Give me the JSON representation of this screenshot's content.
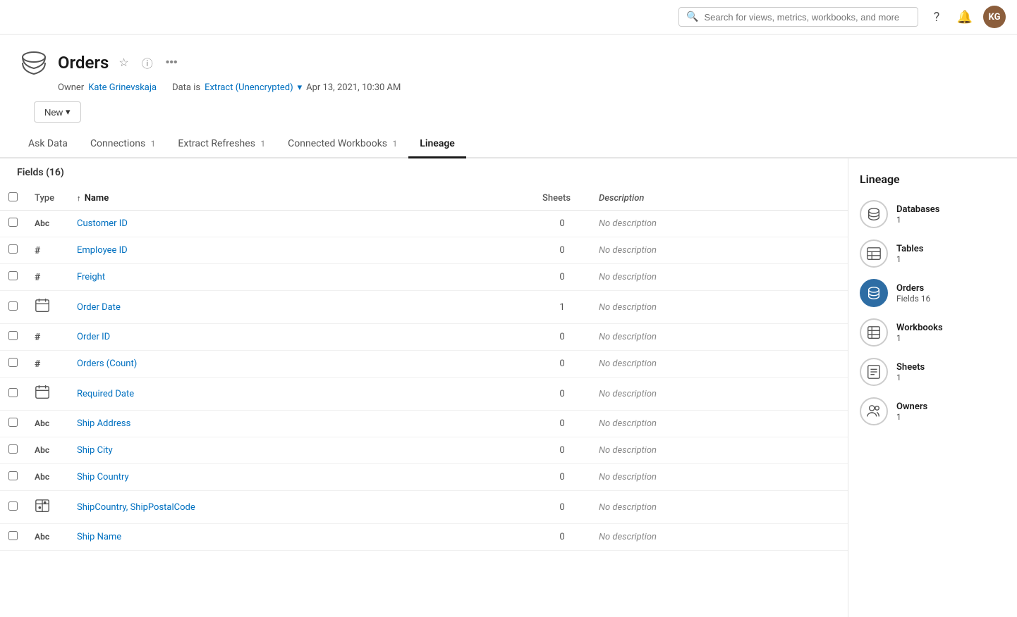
{
  "topnav": {
    "search_placeholder": "Search for views, metrics, workbooks, and more",
    "avatar_initials": "KG"
  },
  "header": {
    "title": "Orders",
    "owner_label": "Owner",
    "owner_name": "Kate Grinevskaja",
    "data_is_label": "Data is",
    "extract_label": "Extract (Unencrypted)",
    "date_label": "Apr 13, 2021, 10:30 AM",
    "new_button": "New"
  },
  "tabs": [
    {
      "id": "ask-data",
      "label": "Ask Data",
      "count": null
    },
    {
      "id": "connections",
      "label": "Connections",
      "count": "1"
    },
    {
      "id": "extract-refreshes",
      "label": "Extract Refreshes",
      "count": "1"
    },
    {
      "id": "connected-workbooks",
      "label": "Connected Workbooks",
      "count": "1"
    },
    {
      "id": "lineage",
      "label": "Lineage",
      "count": null,
      "active": true
    }
  ],
  "fields_section": {
    "heading": "Fields (16)",
    "columns": {
      "type": "Type",
      "name": "Name",
      "sheets": "Sheets",
      "description": "Description"
    },
    "sort_indicator": "↑",
    "rows": [
      {
        "type": "Abc",
        "type_icon": "abc",
        "name": "Customer ID",
        "sheets": 0,
        "description": "No description"
      },
      {
        "type": "#",
        "type_icon": "hash",
        "name": "Employee ID",
        "sheets": 0,
        "description": "No description"
      },
      {
        "type": "#",
        "type_icon": "hash",
        "name": "Freight",
        "sheets": 0,
        "description": "No description"
      },
      {
        "type": "cal",
        "type_icon": "calendar",
        "name": "Order Date",
        "sheets": 1,
        "description": "No description"
      },
      {
        "type": "#",
        "type_icon": "hash",
        "name": "Order ID",
        "sheets": 0,
        "description": "No description"
      },
      {
        "type": "#",
        "type_icon": "hash",
        "name": "Orders (Count)",
        "sheets": 0,
        "description": "No description"
      },
      {
        "type": "cal",
        "type_icon": "calendar",
        "name": "Required Date",
        "sheets": 0,
        "description": "No description"
      },
      {
        "type": "Abc",
        "type_icon": "abc",
        "name": "Ship Address",
        "sheets": 0,
        "description": "No description"
      },
      {
        "type": "Abc",
        "type_icon": "abc",
        "name": "Ship City",
        "sheets": 0,
        "description": "No description"
      },
      {
        "type": "Abc",
        "type_icon": "abc",
        "name": "Ship Country",
        "sheets": 0,
        "description": "No description"
      },
      {
        "type": "geo",
        "type_icon": "geo",
        "name": "ShipCountry, ShipPostalCode",
        "sheets": 0,
        "description": "No description"
      },
      {
        "type": "Abc",
        "type_icon": "abc",
        "name": "Ship Name",
        "sheets": 0,
        "description": "No description"
      }
    ]
  },
  "lineage_panel": {
    "title": "Lineage",
    "items": [
      {
        "id": "databases",
        "label": "Databases",
        "count": "1",
        "icon": "db",
        "active": false
      },
      {
        "id": "tables",
        "label": "Tables",
        "count": "1",
        "icon": "table",
        "active": false
      },
      {
        "id": "orders",
        "label": "Orders",
        "count": "Fields 16",
        "icon": "ds",
        "active": true
      },
      {
        "id": "workbooks",
        "label": "Workbooks",
        "count": "1",
        "icon": "wb",
        "active": false
      },
      {
        "id": "sheets",
        "label": "Sheets",
        "count": "1",
        "icon": "sheet",
        "active": false
      },
      {
        "id": "owners",
        "label": "Owners",
        "count": "1",
        "icon": "owners",
        "active": false
      }
    ]
  }
}
